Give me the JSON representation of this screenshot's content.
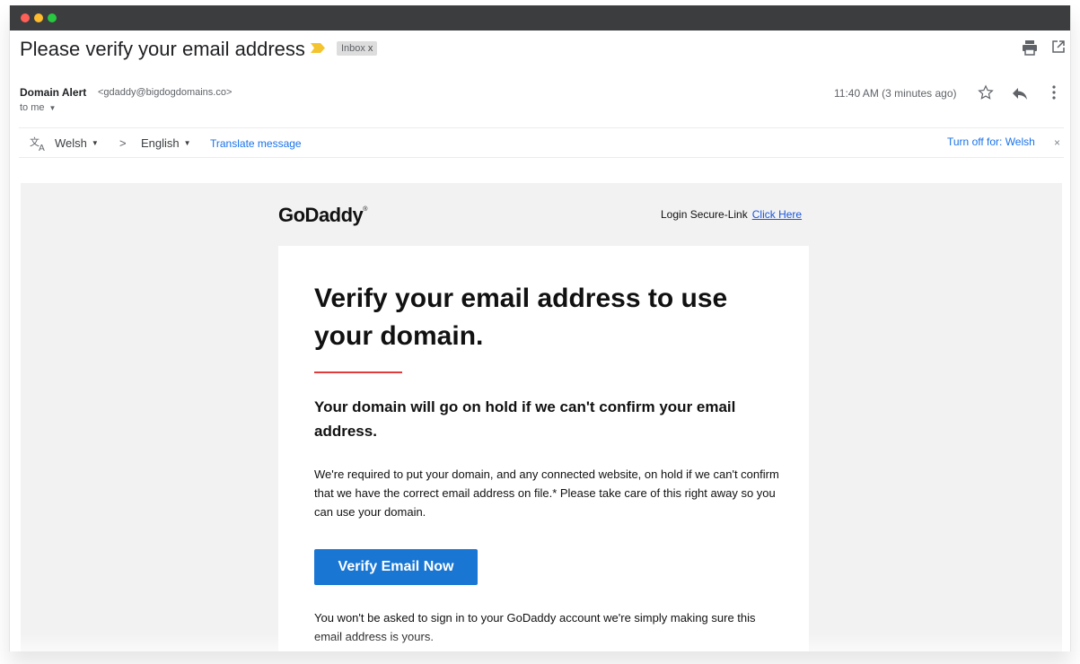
{
  "email": {
    "subject": "Please verify your email address",
    "label_chip": "Inbox",
    "label_chip_close": "x"
  },
  "sender": {
    "name": "Domain Alert",
    "address": "<gdaddy@bigdogdomains.co>",
    "recipient": "to me",
    "timestamp": "11:40 AM (3 minutes ago)"
  },
  "translation": {
    "from_language": "Welsh",
    "arrow": ">",
    "to_language": "English",
    "translate_link": "Translate message",
    "turn_off_link": "Turn off for: Welsh",
    "close": "×"
  },
  "message": {
    "logo": "GoDaddy",
    "login_label": "Login Secure-Link",
    "login_link": "Click Here",
    "headline": "Verify your email address to use your domain.",
    "subhead": "Your domain will go on hold if we can't confirm your email address.",
    "body": "We're required to put your domain, and any connected website, on hold if we can't confirm that we have the correct email address on file.* Please take care of this right away so you can use your domain.",
    "cta_label": "Verify Email Now",
    "footer": "You won't be asked to sign in to your GoDaddy account we're simply making sure this email address is yours."
  },
  "icons": {
    "importance_marker": "importance-marker-icon",
    "print": "print-icon",
    "popout": "open-in-new-window-icon",
    "star": "star-icon",
    "reply": "reply-icon",
    "more": "more-vertical-icon",
    "translate": "translate-icon"
  },
  "colors": {
    "titlebar": "#3c3d3f",
    "link_blue": "#1a73e8",
    "cta_blue": "#1976d2",
    "accent_red": "#e23b3b",
    "importance_yellow": "#f4c430",
    "email_background": "#f2f2f2"
  }
}
